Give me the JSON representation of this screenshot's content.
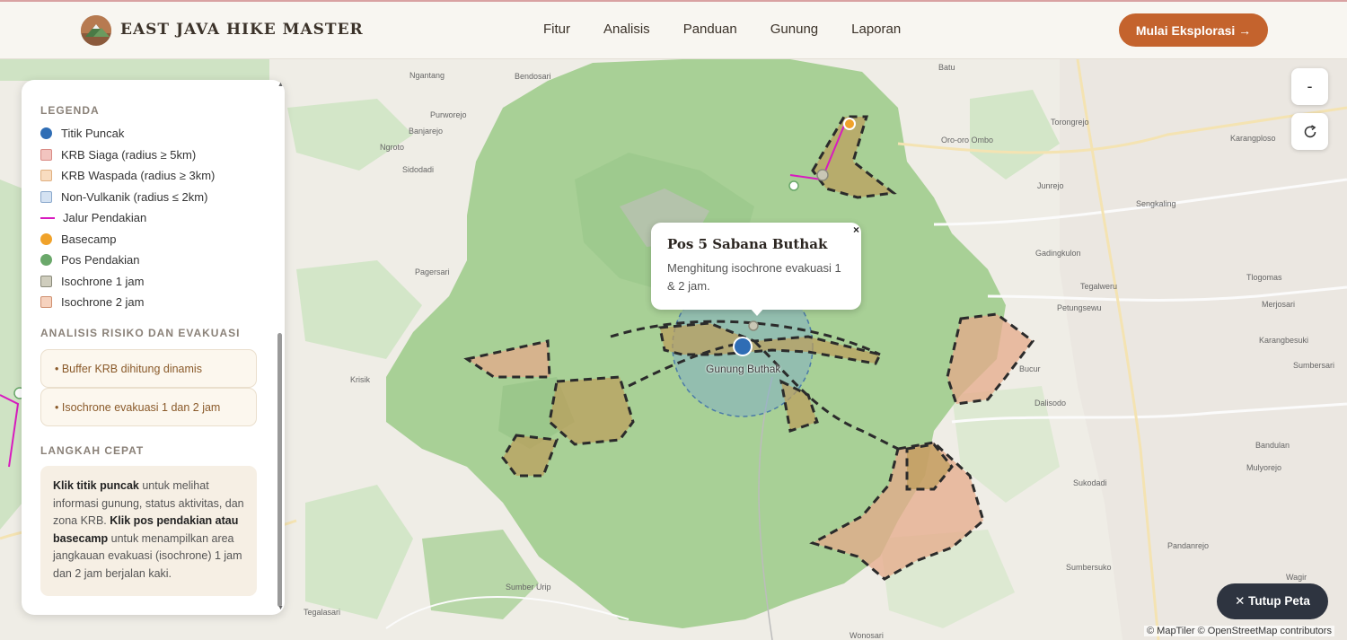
{
  "header": {
    "brand": "EAST JAVA HIKE MASTER",
    "nav": [
      "Fitur",
      "Analisis",
      "Panduan",
      "Gunung",
      "Laporan"
    ],
    "cta_label": "Mulai Eksplorasi →"
  },
  "panel": {
    "legend_title": "LEGENDA",
    "legend": [
      {
        "label": "Titik Puncak",
        "color": "#2f6db5"
      },
      {
        "label": "KRB Siaga (radius ≥ 5km)",
        "color": "#f2b8b3"
      },
      {
        "label": "KRB Waspada (radius ≥ 3km)",
        "color": "#f8d6b5"
      },
      {
        "label": "Non-Vulkanik (radius ≤ 2km)",
        "color": "#c9d9ee"
      },
      {
        "label": "Jalur Pendakian",
        "color": "#d81bbf"
      },
      {
        "label": "Basecamp",
        "color": "#f0a22a"
      },
      {
        "label": "Pos Pendakian",
        "color": "#6aa86a"
      },
      {
        "label": "Isochrone 1 jam",
        "color": "#c9c7b5"
      },
      {
        "label": "Isochrone 2 jam",
        "color": "#f4cbb5"
      }
    ],
    "risk_title": "ANALISIS RISIKO DAN EVAKUASI",
    "risk_items": [
      "• Buffer KRB dihitung dinamis",
      "• Isochrone evakuasi 1 dan 2 jam"
    ],
    "quick_title": "LANGKAH CEPAT",
    "quick": {
      "b1": "Klik titik puncak",
      "t1": " untuk melihat informasi gunung, status aktivitas, dan zona KRB. ",
      "b2": "Klik pos pendakian atau basecamp",
      "t2": " untuk menampilkan area jangkauan evakuasi (isochrone) 1 jam dan 2 jam berjalan kaki."
    }
  },
  "map": {
    "zoom_out_label": "-",
    "refresh_icon": "refresh-icon",
    "popup": {
      "title": "Pos 5 Sabana Buthak",
      "text": "Menghitung isochrone evakuasi 1 & 2 jam.",
      "close": "×"
    },
    "peak_label": "Gunung Buthak",
    "close_button": "✕ Tutup Peta",
    "attribution": "© MapTiler © OpenStreetMap contributors",
    "places": [
      {
        "name": "Batu"
      },
      {
        "name": "Ngantang"
      },
      {
        "name": "Bendosari"
      },
      {
        "name": "Purworejo"
      },
      {
        "name": "Banjarejo"
      },
      {
        "name": "Sidodadi"
      },
      {
        "name": "Ngroto"
      },
      {
        "name": "Pagersari"
      },
      {
        "name": "Krisik"
      },
      {
        "name": "Sumber Urip"
      },
      {
        "name": "Tegalasari"
      },
      {
        "name": "Junrejo"
      },
      {
        "name": "Sengkaling"
      },
      {
        "name": "Karangploso"
      },
      {
        "name": "Gadingkulon"
      },
      {
        "name": "Tegalweru"
      },
      {
        "name": "Petungsewu"
      },
      {
        "name": "Bucur"
      },
      {
        "name": "Dalisodo"
      },
      {
        "name": "Sukodadi"
      },
      {
        "name": "Sumbersuko"
      },
      {
        "name": "Pandanrejo"
      },
      {
        "name": "Mulyorejo"
      },
      {
        "name": "Bandulan"
      },
      {
        "name": "Sumbersari"
      },
      {
        "name": "Karangbesuki"
      },
      {
        "name": "Tlogomas"
      },
      {
        "name": "Merjosari"
      },
      {
        "name": "Wonosari"
      },
      {
        "name": "Oro-oro Ombo"
      },
      {
        "name": "Torongrejo"
      },
      {
        "name": "Wagir"
      }
    ]
  }
}
